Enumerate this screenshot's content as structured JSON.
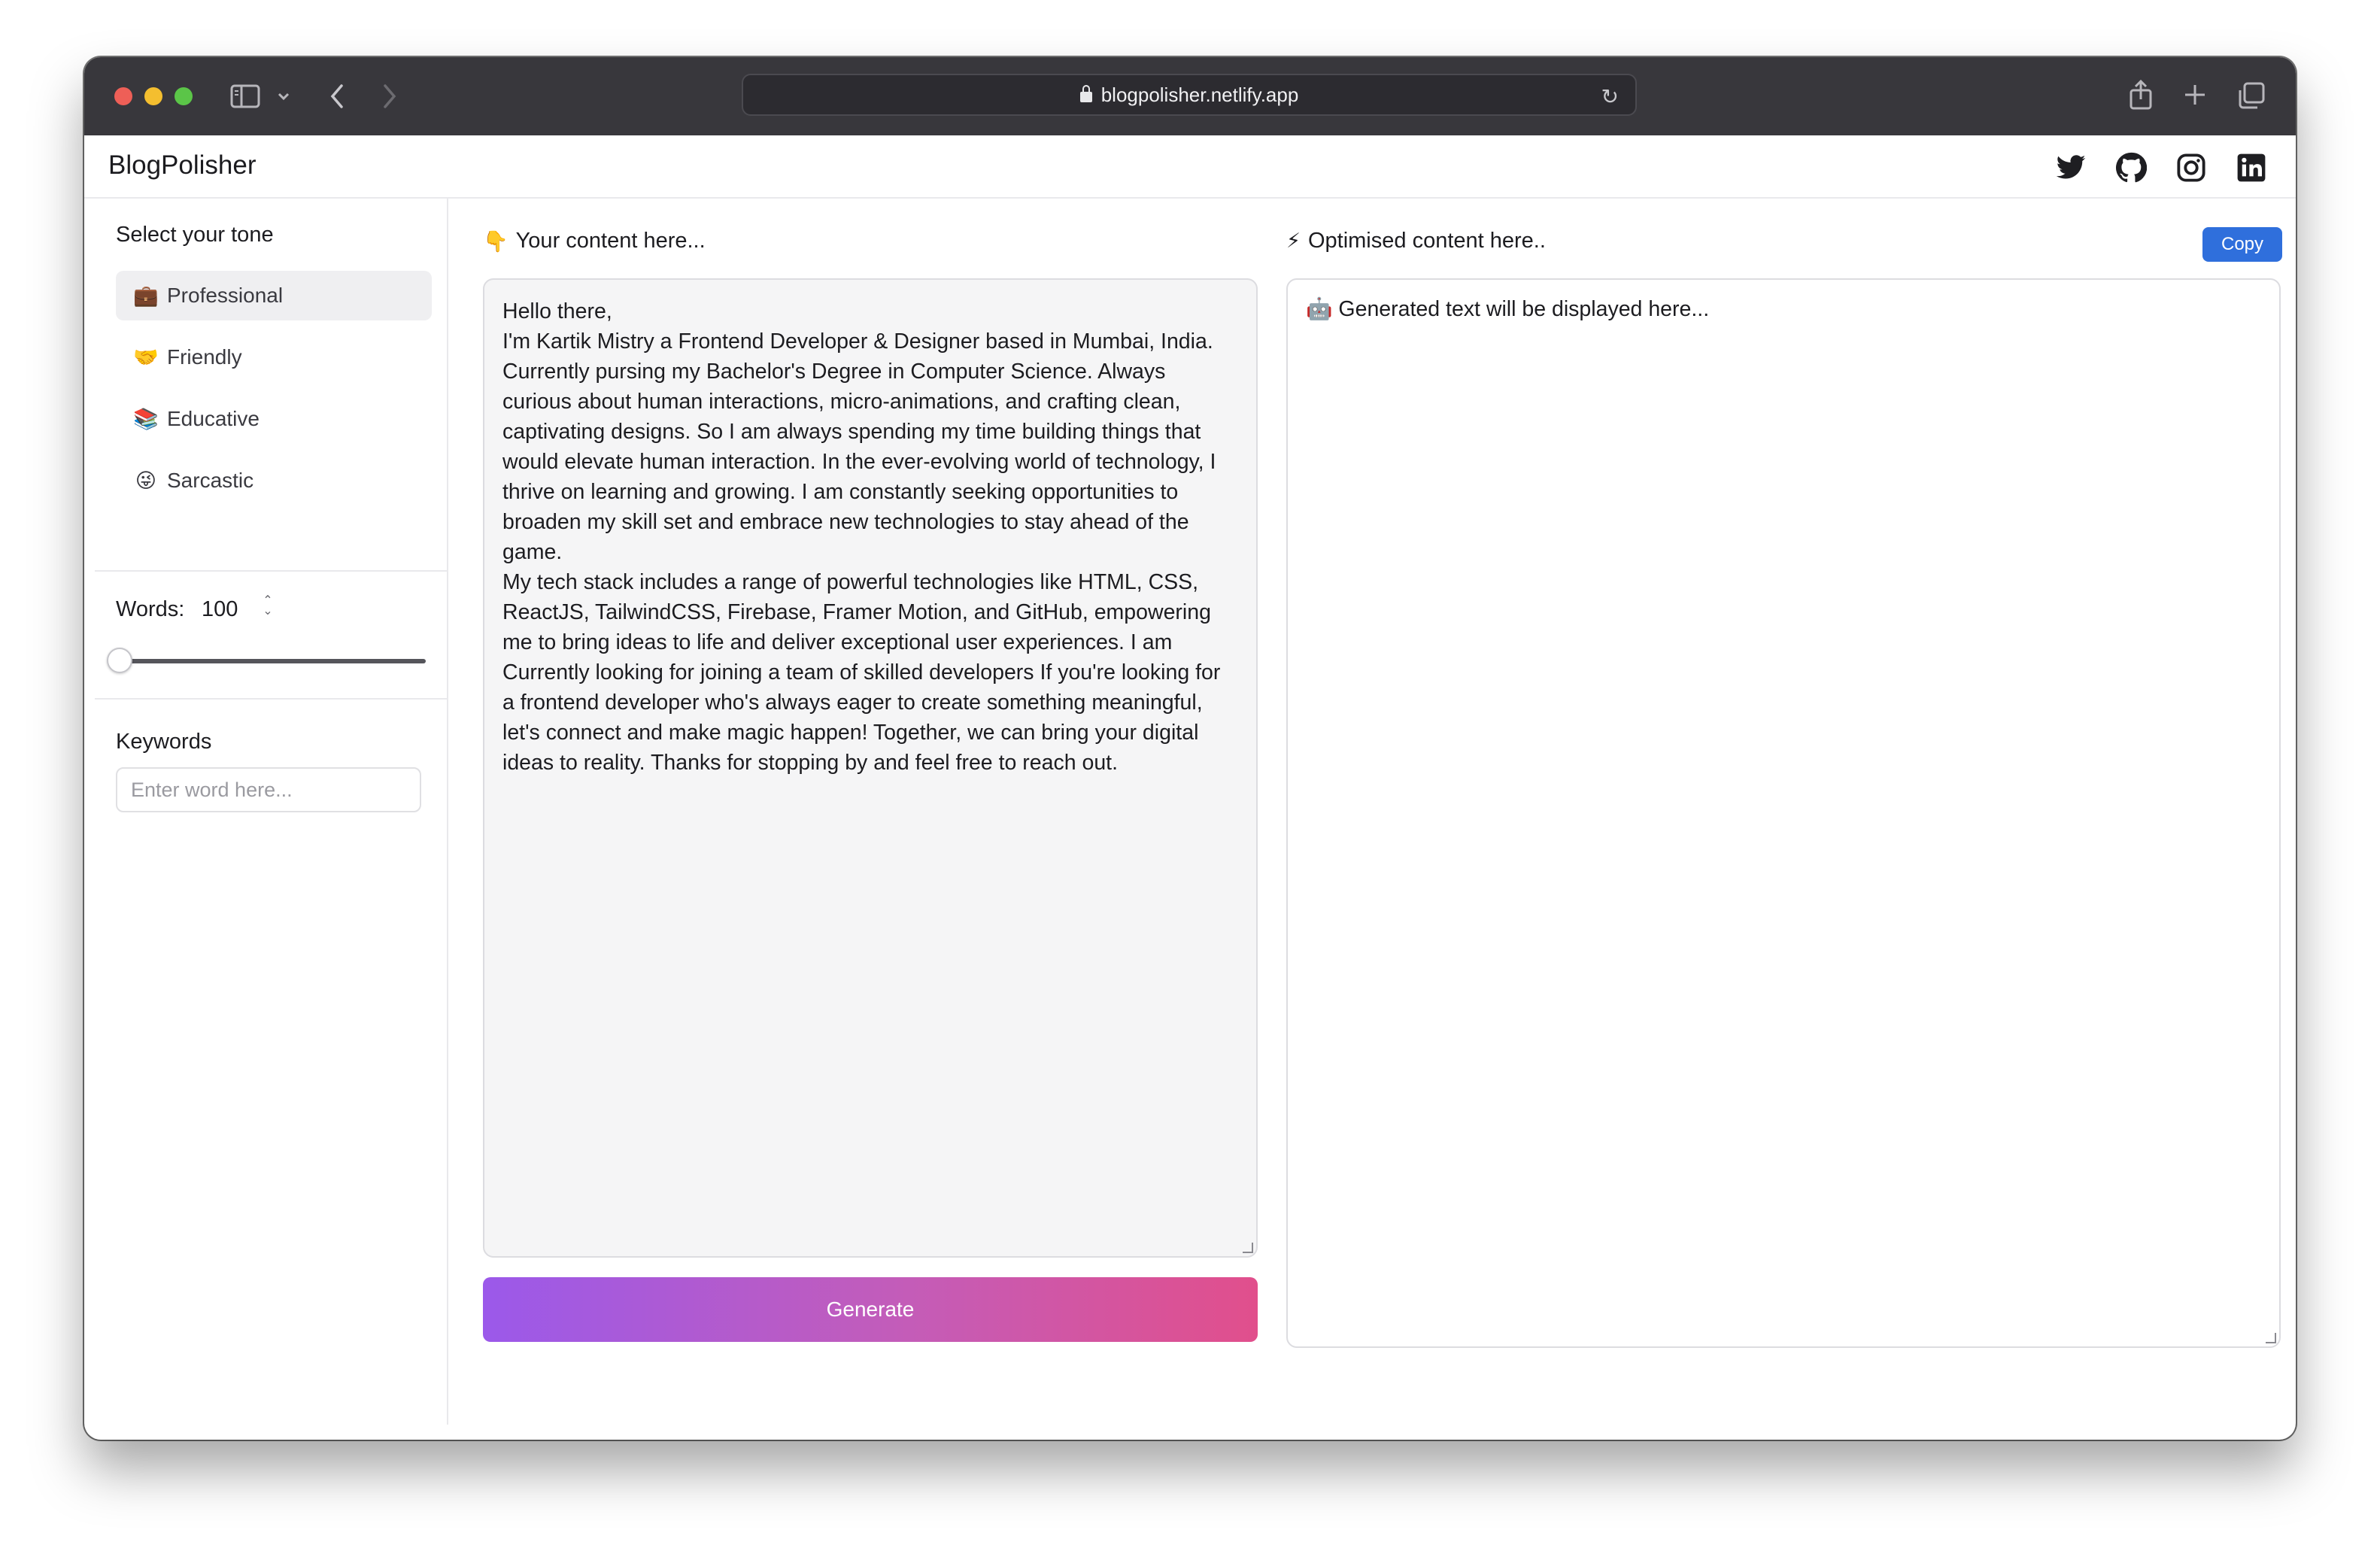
{
  "browser": {
    "url": "blogpolisher.netlify.app"
  },
  "header": {
    "brand": "BlogPolisher",
    "social_icons": [
      "twitter-icon",
      "github-icon",
      "instagram-icon",
      "linkedin-icon"
    ]
  },
  "sidebar": {
    "tone_title": "Select your tone",
    "tones": [
      {
        "emoji": "💼",
        "label": "Professional",
        "active": true
      },
      {
        "emoji": "🤝",
        "label": "Friendly",
        "active": false
      },
      {
        "emoji": "📚",
        "label": "Educative",
        "active": false
      },
      {
        "emoji": "😜",
        "label": "Sarcastic",
        "active": false
      }
    ],
    "words_label": "Words:",
    "words_value": "100",
    "words_slider_fraction": 0,
    "keywords_label": "Keywords",
    "keywords_placeholder": "Enter word here..."
  },
  "input_panel": {
    "emoji": "👇",
    "label": "Your content here...",
    "content": "Hello there,\nI'm Kartik Mistry a Frontend Developer & Designer based in Mumbai, India. Currently pursing my Bachelor's Degree in Computer Science. Always curious about human interactions, micro-animations, and crafting clean, captivating designs. So I am always spending my time building things that would elevate human interaction. In the ever-evolving world of technology, I thrive on learning and growing. I am constantly seeking opportunities to broaden my skill set and embrace new technologies to stay ahead of the game.\nMy tech stack includes a range of powerful technologies like HTML, CSS, ReactJS, TailwindCSS, Firebase, Framer Motion, and GitHub, empowering me to bring ideas to life and deliver exceptional user experiences. I am Currently looking for joining a team of skilled developers If you're looking for a frontend developer who's always eager to create something meaningful, let's connect and make magic happen! Together, we can bring your digital ideas to reality. Thanks for stopping by and feel free to reach out.",
    "generate_label": "Generate"
  },
  "output_panel": {
    "emoji": "⚡",
    "label": "Optimised content here..",
    "copy_label": "Copy",
    "placeholder_emoji": "🤖",
    "placeholder_text": "Generated text will be displayed here..."
  },
  "colors": {
    "titlebar": "#38373c",
    "copy_button": "#2f6fdc",
    "gradient_start": "#9b59ea",
    "gradient_end": "#e14f8c"
  }
}
